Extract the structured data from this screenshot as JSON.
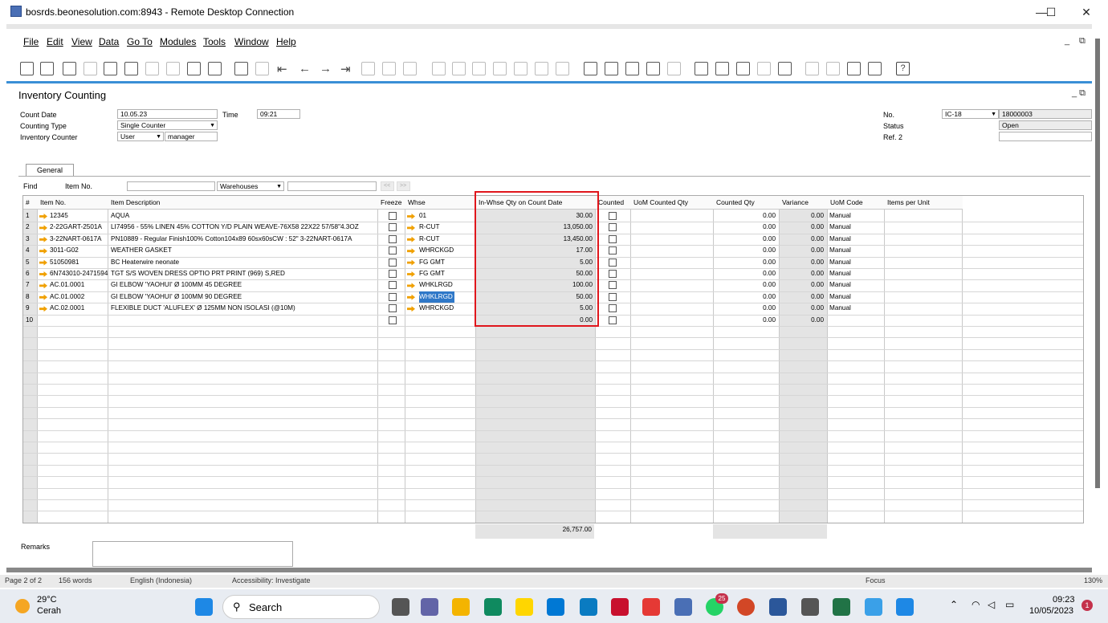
{
  "window": {
    "title": "bosrds.beonesolution.com:8943 - Remote Desktop Connection",
    "controls": [
      "—",
      "☐",
      "✕"
    ]
  },
  "menu": [
    "File",
    "Edit",
    "View",
    "Data",
    "Go To",
    "Modules",
    "Tools",
    "Window",
    "Help"
  ],
  "form": {
    "title": "Inventory Counting",
    "count_date_label": "Count Date",
    "count_date": "10.05.23",
    "time_label": "Time",
    "time": "09:21",
    "counting_type_label": "Counting Type",
    "counting_type": "Single Counter",
    "inventory_counter_label": "Inventory Counter",
    "counter_type": "User",
    "counter_name": "manager",
    "no_label": "No.",
    "series": "IC-18",
    "doc_no": "18000003",
    "status_label": "Status",
    "status": "Open",
    "ref2_label": "Ref. 2",
    "ref2": "",
    "tab_general": "General",
    "find_label": "Find",
    "find_item_label": "Item No.",
    "warehouses": "Warehouses",
    "remarks_label": "Remarks"
  },
  "grid": {
    "headers": {
      "num": "#",
      "item_no": "Item No.",
      "desc": "Item Description",
      "freeze": "Freeze",
      "whse": "Whse",
      "inwhse": "In-Whse Qty on Count Date",
      "counted": "Counted",
      "uom_counted": "UoM Counted Qty",
      "counted_qty": "Counted Qty",
      "variance": "Variance",
      "uom_code": "UoM Code",
      "items_per_unit": "Items per Unit"
    },
    "rows": [
      {
        "n": "1",
        "item": "12345",
        "desc": "AQUA",
        "whse": "01",
        "qty": "30.00",
        "cqty": "0.00",
        "var": "0.00",
        "uom": "Manual"
      },
      {
        "n": "2",
        "item": "2-22GART-2501A",
        "desc": "LI74956 - 55% LINEN 45% COTTON Y/D PLAIN WEAVE-76X58 22X22 57/58\"4.3OZ",
        "whse": "R-CUT",
        "qty": "13,050.00",
        "cqty": "0.00",
        "var": "0.00",
        "uom": "Manual"
      },
      {
        "n": "3",
        "item": "3-22NART-0617A",
        "desc": "PN10889 - Regular Finish100% Cotton104x89 60sx60sCW : 52\" 3-22NART-0617A",
        "whse": "R-CUT",
        "qty": "13,450.00",
        "cqty": "0.00",
        "var": "0.00",
        "uom": "Manual"
      },
      {
        "n": "4",
        "item": "3011-G02",
        "desc": "WEATHER GASKET",
        "whse": "WHRCKGD",
        "qty": "17.00",
        "cqty": "0.00",
        "var": "0.00",
        "uom": "Manual"
      },
      {
        "n": "5",
        "item": "51050981",
        "desc": "BC Heaterwire neonate",
        "whse": "FG GMT",
        "qty": "5.00",
        "cqty": "0.00",
        "var": "0.00",
        "uom": "Manual"
      },
      {
        "n": "6",
        "item": "6N743010-2471594",
        "desc": "TGT S/S WOVEN DRESS OPTIO PRT PRINT (969) S,RED",
        "whse": "FG GMT",
        "qty": "50.00",
        "cqty": "0.00",
        "var": "0.00",
        "uom": "Manual"
      },
      {
        "n": "7",
        "item": "AC.01.0001",
        "desc": "GI ELBOW 'YAOHUI' Ø 100MM 45 DEGREE",
        "whse": "WHKLRGD",
        "qty": "100.00",
        "cqty": "0.00",
        "var": "0.00",
        "uom": "Manual"
      },
      {
        "n": "8",
        "item": "AC.01.0002",
        "desc": "GI ELBOW 'YAOHUI' Ø 100MM 90 DEGREE",
        "whse": "WHKLRGD",
        "qty": "50.00",
        "cqty": "0.00",
        "var": "0.00",
        "uom": "Manual"
      },
      {
        "n": "9",
        "item": "AC.02.0001",
        "desc": "FLEXIBLE DUCT 'ALUFLEX' Ø 125MM NON ISOLASI (@10M)",
        "whse": "WHRCKGD",
        "qty": "5.00",
        "cqty": "0.00",
        "var": "0.00",
        "uom": "Manual"
      },
      {
        "n": "10",
        "item": "",
        "desc": "",
        "whse": "",
        "qty": "0.00",
        "cqty": "0.00",
        "var": "0.00",
        "uom": ""
      }
    ],
    "total": "26,757.00"
  },
  "status": {
    "page": "Page 2 of 2",
    "words": "156 words",
    "lang": "English (Indonesia)",
    "access": "Accessibility: Investigate",
    "focus": "Focus",
    "zoom": "130%"
  },
  "taskbar": {
    "temp": "29°C",
    "weather": "Cerah",
    "search": "Search",
    "badge": "25",
    "time": "09:23",
    "date": "10/05/2023",
    "notif": "1"
  }
}
